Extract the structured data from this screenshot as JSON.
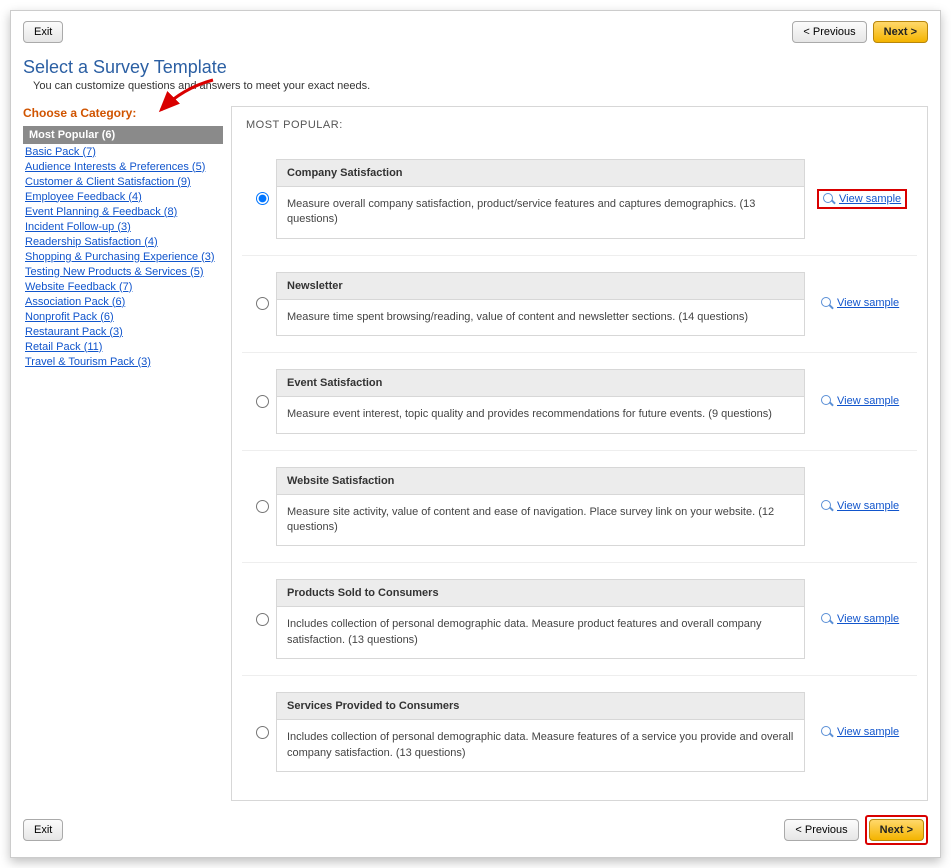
{
  "buttons": {
    "exit": "Exit",
    "previous": "< Previous",
    "next": "Next >"
  },
  "header": {
    "title": "Select a Survey Template",
    "subtitle": "You can customize questions and answers to meet your exact needs."
  },
  "sidebar": {
    "label": "Choose a Category:",
    "selected": "Most Popular (6)",
    "items": [
      "Basic Pack (7)",
      "Audience Interests & Preferences (5)",
      "Customer & Client Satisfaction (9)",
      "Employee Feedback (4)",
      "Event Planning & Feedback (8)",
      "Incident Follow-up (3)",
      "Readership Satisfaction (4)",
      "Shopping & Purchasing Experience (3)",
      "Testing New Products & Services (5)",
      "Website Feedback (7)",
      "Association Pack (6)",
      "Nonprofit Pack (6)",
      "Restaurant Pack (3)",
      "Retail Pack (11)",
      "Travel & Tourism Pack (3)"
    ]
  },
  "main": {
    "section_title": "MOST POPULAR:",
    "view_sample": "View sample",
    "templates": [
      {
        "title": "Company Satisfaction",
        "desc": "Measure overall company satisfaction, product/service features and captures demographics. (13 questions)",
        "selected": true,
        "highlight": true
      },
      {
        "title": "Newsletter",
        "desc": "Measure time spent browsing/reading, value of content and newsletter sections. (14 questions)",
        "selected": false,
        "highlight": false
      },
      {
        "title": "Event Satisfaction",
        "desc": "Measure event interest, topic quality and provides recommendations for future events. (9 questions)",
        "selected": false,
        "highlight": false
      },
      {
        "title": "Website Satisfaction",
        "desc": "Measure site activity, value of content and ease of navigation. Place survey link on your website. (12 questions)",
        "selected": false,
        "highlight": false
      },
      {
        "title": "Products Sold to Consumers",
        "desc": "Includes collection of personal demographic data. Measure product features and overall company satisfaction. (13 questions)",
        "selected": false,
        "highlight": false
      },
      {
        "title": "Services Provided to Consumers",
        "desc": "Includes collection of personal demographic data. Measure features of a service you provide and overall company satisfaction. (13 questions)",
        "selected": false,
        "highlight": false
      }
    ]
  }
}
